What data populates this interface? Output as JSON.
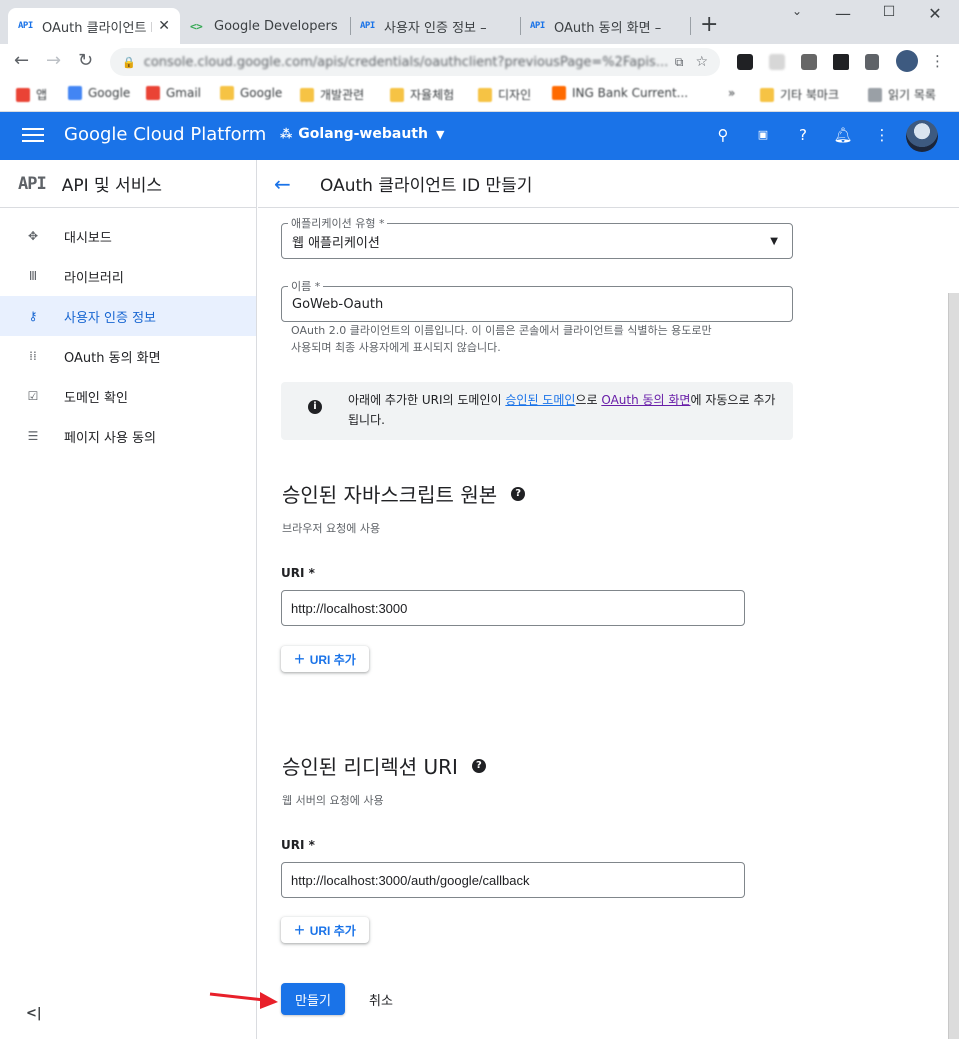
{
  "browser": {
    "tabs": [
      {
        "favicon": "API",
        "title": "OAuth 클라이언트 I"
      },
      {
        "favicon": "google-developers-icon",
        "title": "Google Developers"
      },
      {
        "favicon": "API",
        "title": "사용자 인증 정보 –"
      },
      {
        "favicon": "API",
        "title": "OAuth 동의 화면 –"
      }
    ],
    "url": "console.cloud.google.com/apis/credentials/oauthclient?previousPage=%2Fapis..."
  },
  "bookmarks": [
    "앱",
    "Google",
    "Gmail",
    "Google",
    "개발관련",
    "자율체험",
    "디자인",
    "ING Bank Current...",
    "기타 북마크",
    "읽기 목록"
  ],
  "header": {
    "brand": "Google Cloud Platform",
    "project": "Golang-webauth"
  },
  "sidebar": {
    "logo": "API",
    "title": "API 및 서비스",
    "items": [
      {
        "label": "대시보드",
        "icon": "dashboard-icon"
      },
      {
        "label": "라이브러리",
        "icon": "library-icon"
      },
      {
        "label": "사용자 인증 정보",
        "icon": "key-icon"
      },
      {
        "label": "OAuth 동의 화면",
        "icon": "consent-icon"
      },
      {
        "label": "도메인 확인",
        "icon": "domain-check-icon"
      },
      {
        "label": "페이지 사용 동의",
        "icon": "page-usage-icon"
      }
    ],
    "collapse": "<|"
  },
  "main": {
    "title": "OAuth 클라이언트 ID 만들기",
    "app_type": {
      "label": "애플리케이션 유형 *",
      "value": "웹 애플리케이션"
    },
    "name": {
      "label": "이름 *",
      "value": "GoWeb-Oauth",
      "hint_line1": "OAuth 2.0 클라이언트의 이름입니다. 이 이름은 콘솔에서 클라이언트를 식별하는 용도로만",
      "hint_line2": "사용되며 최종 사용자에게 표시되지 않습니다."
    },
    "info": {
      "part1": "아래에 추가한 URI의 도메인이 ",
      "link1": "승인된 도메인",
      "part2": "으로 ",
      "link2": "OAuth 동의 화면",
      "part3": "에 자동으로 추가됩니다."
    },
    "js_origins": {
      "title": "승인된 자바스크립트 원본",
      "subtitle": "브라우저 요청에 사용",
      "uri_label": "URI *",
      "uri_value": "http://localhost:3000",
      "add_label": "URI 추가"
    },
    "redirect_uris": {
      "title": "승인된 리디렉션 URI",
      "subtitle": "웹 서버의 요청에 사용",
      "uri_label": "URI *",
      "uri_value": "http://localhost:3000/auth/google/callback",
      "add_label": "URI 추가"
    },
    "create_label": "만들기",
    "cancel_label": "취소"
  },
  "colors": {
    "accent": "#1a73e8",
    "annotation_arrow": "#e8202a"
  }
}
